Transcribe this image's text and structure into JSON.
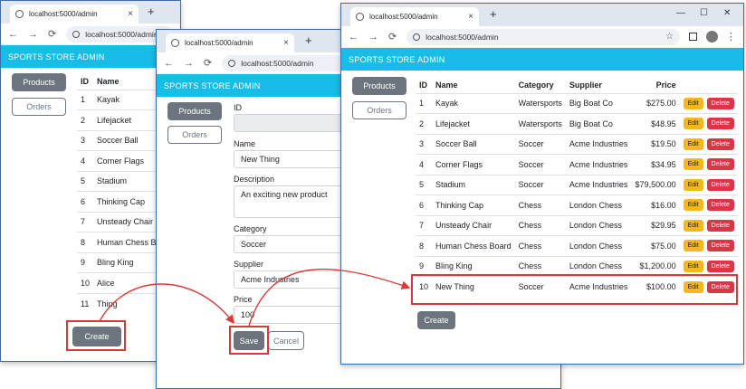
{
  "browser": {
    "tab_title": "localhost:5000/admin",
    "url": "localhost:5000/admin",
    "tab_close": "×",
    "new_tab": "+",
    "back": "←",
    "forward": "→",
    "reload": "⟳",
    "minimize": "—",
    "maximize": "☐",
    "close": "✕"
  },
  "app": {
    "brand": "SPORTS STORE ADMIN",
    "nav_products": "Products",
    "nav_orders": "Orders"
  },
  "window1": {
    "columns": [
      "ID",
      "Name"
    ],
    "rows": [
      [
        "1",
        "Kayak"
      ],
      [
        "2",
        "Lifejacket"
      ],
      [
        "3",
        "Soccer Ball"
      ],
      [
        "4",
        "Corner Flags"
      ],
      [
        "5",
        "Stadium"
      ],
      [
        "6",
        "Thinking Cap"
      ],
      [
        "7",
        "Unsteady Chair"
      ],
      [
        "8",
        "Human Chess Bo"
      ],
      [
        "9",
        "Bling King"
      ],
      [
        "10",
        "Alice"
      ],
      [
        "11",
        "Thing"
      ]
    ],
    "create_label": "Create"
  },
  "window2": {
    "fields": {
      "id_label": "ID",
      "name_label": "Name",
      "name_value": "New Thing",
      "description_label": "Description",
      "description_value": "An exciting new product",
      "category_label": "Category",
      "category_value": "Soccer",
      "supplier_label": "Supplier",
      "supplier_value": "Acme Industries",
      "price_label": "Price",
      "price_value": "100"
    },
    "save_label": "Save",
    "cancel_label": "Cancel"
  },
  "window3": {
    "columns": [
      "ID",
      "Name",
      "Category",
      "Supplier",
      "Price"
    ],
    "rows": [
      [
        "1",
        "Kayak",
        "Watersports",
        "Big Boat Co",
        "$275.00"
      ],
      [
        "2",
        "Lifejacket",
        "Watersports",
        "Big Boat Co",
        "$48.95"
      ],
      [
        "3",
        "Soccer Ball",
        "Soccer",
        "Acme Industries",
        "$19.50"
      ],
      [
        "4",
        "Corner Flags",
        "Soccer",
        "Acme Industries",
        "$34.95"
      ],
      [
        "5",
        "Stadium",
        "Soccer",
        "Acme Industries",
        "$79,500.00"
      ],
      [
        "6",
        "Thinking Cap",
        "Chess",
        "London Chess",
        "$16.00"
      ],
      [
        "7",
        "Unsteady Chair",
        "Chess",
        "London Chess",
        "$29.95"
      ],
      [
        "8",
        "Human Chess Board",
        "Chess",
        "London Chess",
        "$75.00"
      ],
      [
        "9",
        "Bling King",
        "Chess",
        "London Chess",
        "$1,200.00"
      ],
      [
        "10",
        "New Thing",
        "Soccer",
        "Acme Industries",
        "$100.00"
      ]
    ],
    "edit_label": "Edit",
    "delete_label": "Delete",
    "create_label": "Create"
  },
  "colors": {
    "banner": "#17bde6",
    "highlight": "#d43c3c",
    "edit": "#f3b81e",
    "delete": "#dc3545",
    "secondary": "#6c757d"
  }
}
